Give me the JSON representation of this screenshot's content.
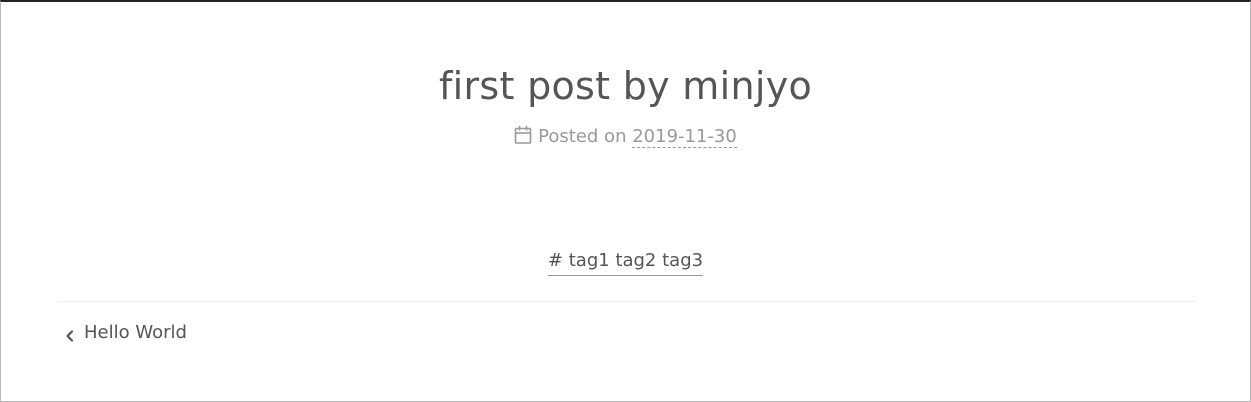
{
  "post": {
    "title": "first post by minjyo",
    "meta_prefix": "Posted on",
    "date": "2019-11-30",
    "tags": "# tag1 tag2 tag3"
  },
  "navigation": {
    "prev_label": "Hello World"
  },
  "icons": {
    "meta": "calendar-icon",
    "prev": "chevron-left-icon"
  },
  "colors": {
    "text": "#555555",
    "meta_text": "#999999",
    "top_border": "#222222",
    "divider": "#eeeeee"
  }
}
